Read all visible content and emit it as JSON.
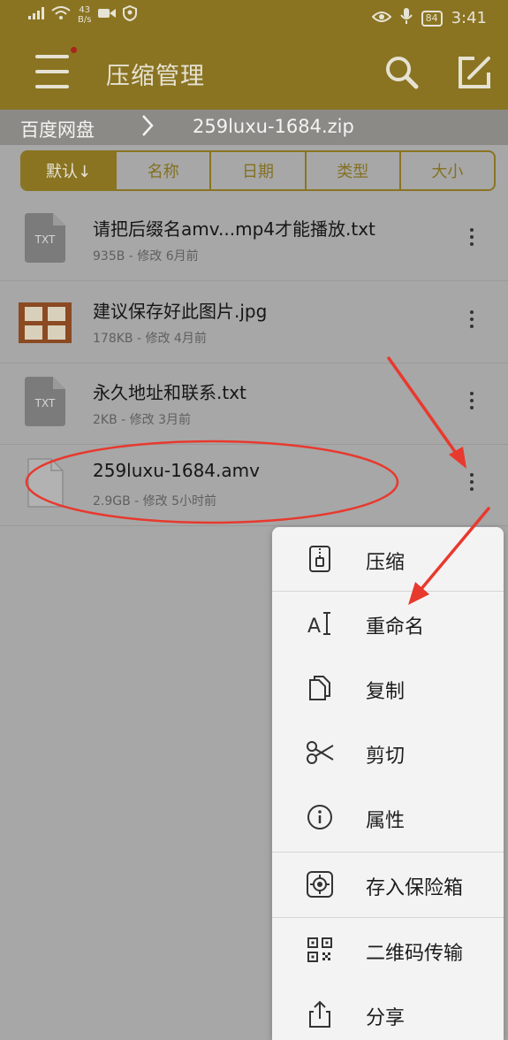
{
  "status_bar": {
    "net_speed_top": "43",
    "net_speed_unit": "B/s",
    "battery": "84",
    "time": "3:41"
  },
  "app_bar": {
    "title": "压缩管理"
  },
  "breadcrumb": {
    "root": "百度网盘",
    "current": "259luxu-1684.zip"
  },
  "sort_tabs": [
    "默认↓",
    "名称",
    "日期",
    "类型",
    "大小"
  ],
  "files": [
    {
      "name": "请把后缀名amv...mp4才能播放.txt",
      "meta": "935B - 修改 6月前",
      "icon": "txt-file-icon",
      "icon_text": "TXT"
    },
    {
      "name": "建议保存好此图片.jpg",
      "meta": "178KB - 修改 4月前",
      "icon": "image-thumbnail"
    },
    {
      "name": "永久地址和联系.txt",
      "meta": "2KB - 修改 3月前",
      "icon": "txt-file-icon",
      "icon_text": "TXT"
    },
    {
      "name": "259luxu-1684.amv",
      "meta": "2.9GB - 修改 5小时前",
      "icon": "generic-file-icon"
    }
  ],
  "context_menu": [
    {
      "label": "压缩",
      "icon": "zip-icon"
    },
    {
      "label": "重命名",
      "icon": "rename-icon"
    },
    {
      "label": "复制",
      "icon": "copy-icon"
    },
    {
      "label": "剪切",
      "icon": "scissors-icon"
    },
    {
      "label": "属性",
      "icon": "info-icon"
    },
    {
      "label": "存入保险箱",
      "icon": "safe-icon"
    },
    {
      "label": "二维码传输",
      "icon": "qr-code-icon"
    },
    {
      "label": "分享",
      "icon": "share-icon"
    }
  ],
  "colors": {
    "accent": "#8a7422",
    "annotation": "#e8392e",
    "overlay_bg": "#a7a7a7"
  }
}
